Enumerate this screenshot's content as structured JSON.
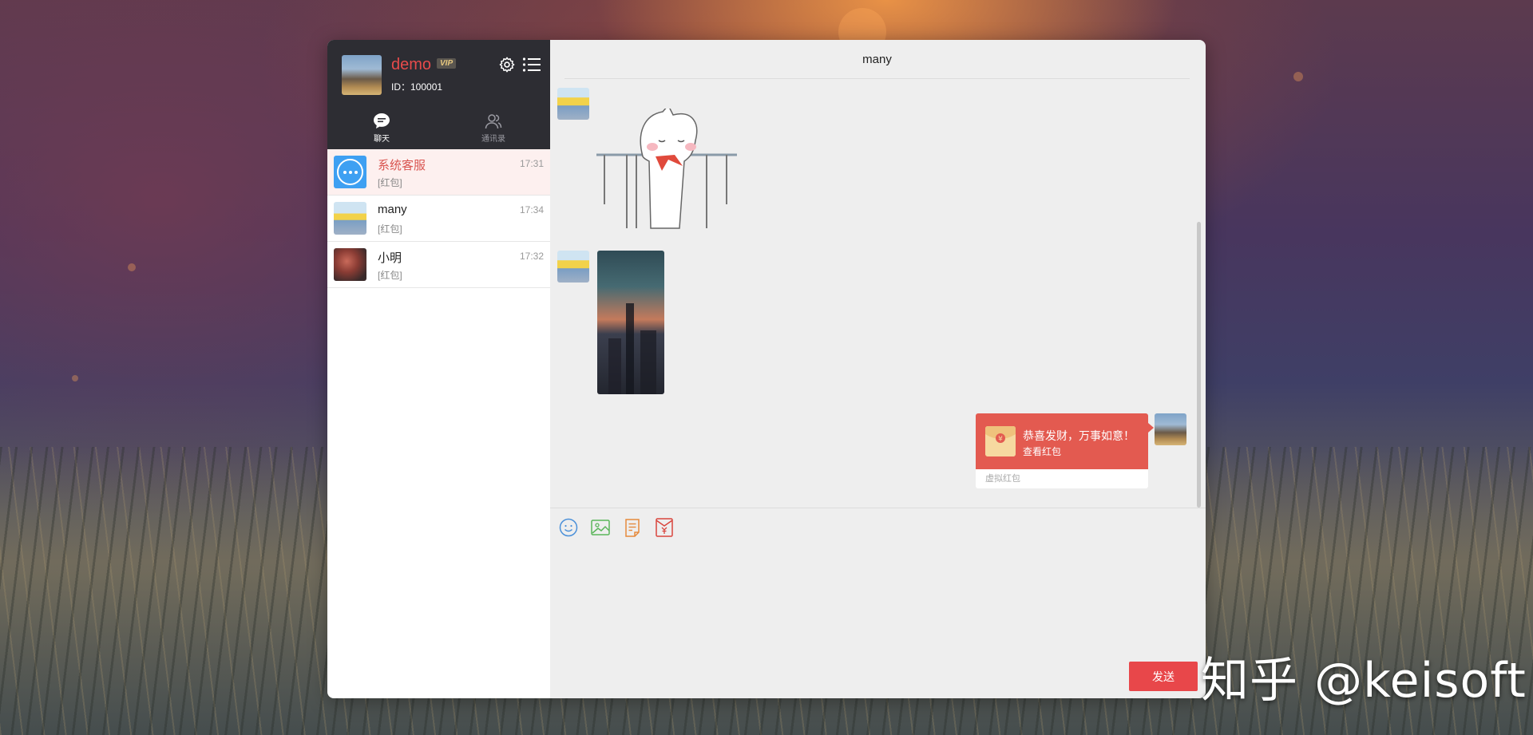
{
  "user": {
    "name": "demo",
    "vip_badge": "VIP",
    "id_label": "ID：100001"
  },
  "tabs": [
    {
      "label": "聊天",
      "active": true
    },
    {
      "label": "通讯录",
      "active": false
    }
  ],
  "conversations": [
    {
      "name": "系统客服",
      "time": "17:31",
      "preview": "[红包]",
      "active": true
    },
    {
      "name": "many",
      "time": "17:34",
      "preview": "[红包]",
      "active": false
    },
    {
      "name": "小明",
      "time": "17:32",
      "preview": "[红包]",
      "active": false
    }
  ],
  "chat": {
    "title": "many",
    "red_packet": {
      "title": "恭喜发财，万事如意！",
      "subtitle": "查看红包",
      "footer": "虚拟红包"
    },
    "send_label": "发送"
  },
  "toolbar": {
    "icons": [
      "emoji-icon",
      "image-icon",
      "document-icon",
      "red-packet-icon"
    ]
  },
  "colors": {
    "accent": "#e8474a",
    "sidebar_header": "#2d2d33",
    "chat_bg": "#eeeeee"
  },
  "watermark": "知乎 @keisoft"
}
